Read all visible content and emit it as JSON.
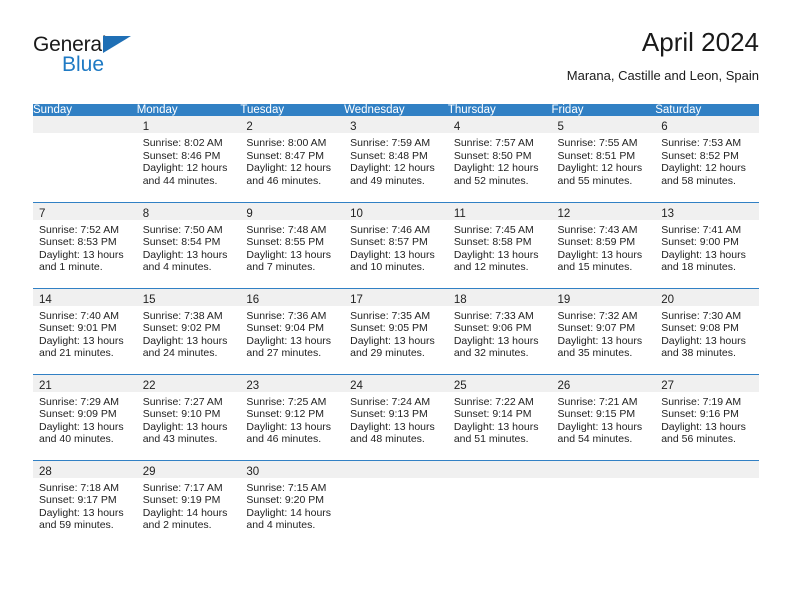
{
  "brand": {
    "name_top": "General",
    "name_bottom": "Blue",
    "triangle_color": "#1f6fb5",
    "blue_color": "#1f7ac4"
  },
  "header": {
    "month_title": "April 2024",
    "location": "Marana, Castille and Leon, Spain"
  },
  "theme": {
    "header_blue": "#3180c4",
    "daynum_band": "#f0f0f0",
    "text": "#222222"
  },
  "weekdays": [
    "Sunday",
    "Monday",
    "Tuesday",
    "Wednesday",
    "Thursday",
    "Friday",
    "Saturday"
  ],
  "labels": {
    "sunrise_prefix": "Sunrise:",
    "sunset_prefix": "Sunset:",
    "daylight_prefix": "Daylight:"
  },
  "weeks": [
    [
      {
        "day": "",
        "sunrise": "",
        "sunset": "",
        "daylight": ""
      },
      {
        "day": "1",
        "sunrise": "Sunrise: 8:02 AM",
        "sunset": "Sunset: 8:46 PM",
        "daylight": "Daylight: 12 hours and 44 minutes."
      },
      {
        "day": "2",
        "sunrise": "Sunrise: 8:00 AM",
        "sunset": "Sunset: 8:47 PM",
        "daylight": "Daylight: 12 hours and 46 minutes."
      },
      {
        "day": "3",
        "sunrise": "Sunrise: 7:59 AM",
        "sunset": "Sunset: 8:48 PM",
        "daylight": "Daylight: 12 hours and 49 minutes."
      },
      {
        "day": "4",
        "sunrise": "Sunrise: 7:57 AM",
        "sunset": "Sunset: 8:50 PM",
        "daylight": "Daylight: 12 hours and 52 minutes."
      },
      {
        "day": "5",
        "sunrise": "Sunrise: 7:55 AM",
        "sunset": "Sunset: 8:51 PM",
        "daylight": "Daylight: 12 hours and 55 minutes."
      },
      {
        "day": "6",
        "sunrise": "Sunrise: 7:53 AM",
        "sunset": "Sunset: 8:52 PM",
        "daylight": "Daylight: 12 hours and 58 minutes."
      }
    ],
    [
      {
        "day": "7",
        "sunrise": "Sunrise: 7:52 AM",
        "sunset": "Sunset: 8:53 PM",
        "daylight": "Daylight: 13 hours and 1 minute."
      },
      {
        "day": "8",
        "sunrise": "Sunrise: 7:50 AM",
        "sunset": "Sunset: 8:54 PM",
        "daylight": "Daylight: 13 hours and 4 minutes."
      },
      {
        "day": "9",
        "sunrise": "Sunrise: 7:48 AM",
        "sunset": "Sunset: 8:55 PM",
        "daylight": "Daylight: 13 hours and 7 minutes."
      },
      {
        "day": "10",
        "sunrise": "Sunrise: 7:46 AM",
        "sunset": "Sunset: 8:57 PM",
        "daylight": "Daylight: 13 hours and 10 minutes."
      },
      {
        "day": "11",
        "sunrise": "Sunrise: 7:45 AM",
        "sunset": "Sunset: 8:58 PM",
        "daylight": "Daylight: 13 hours and 12 minutes."
      },
      {
        "day": "12",
        "sunrise": "Sunrise: 7:43 AM",
        "sunset": "Sunset: 8:59 PM",
        "daylight": "Daylight: 13 hours and 15 minutes."
      },
      {
        "day": "13",
        "sunrise": "Sunrise: 7:41 AM",
        "sunset": "Sunset: 9:00 PM",
        "daylight": "Daylight: 13 hours and 18 minutes."
      }
    ],
    [
      {
        "day": "14",
        "sunrise": "Sunrise: 7:40 AM",
        "sunset": "Sunset: 9:01 PM",
        "daylight": "Daylight: 13 hours and 21 minutes."
      },
      {
        "day": "15",
        "sunrise": "Sunrise: 7:38 AM",
        "sunset": "Sunset: 9:02 PM",
        "daylight": "Daylight: 13 hours and 24 minutes."
      },
      {
        "day": "16",
        "sunrise": "Sunrise: 7:36 AM",
        "sunset": "Sunset: 9:04 PM",
        "daylight": "Daylight: 13 hours and 27 minutes."
      },
      {
        "day": "17",
        "sunrise": "Sunrise: 7:35 AM",
        "sunset": "Sunset: 9:05 PM",
        "daylight": "Daylight: 13 hours and 29 minutes."
      },
      {
        "day": "18",
        "sunrise": "Sunrise: 7:33 AM",
        "sunset": "Sunset: 9:06 PM",
        "daylight": "Daylight: 13 hours and 32 minutes."
      },
      {
        "day": "19",
        "sunrise": "Sunrise: 7:32 AM",
        "sunset": "Sunset: 9:07 PM",
        "daylight": "Daylight: 13 hours and 35 minutes."
      },
      {
        "day": "20",
        "sunrise": "Sunrise: 7:30 AM",
        "sunset": "Sunset: 9:08 PM",
        "daylight": "Daylight: 13 hours and 38 minutes."
      }
    ],
    [
      {
        "day": "21",
        "sunrise": "Sunrise: 7:29 AM",
        "sunset": "Sunset: 9:09 PM",
        "daylight": "Daylight: 13 hours and 40 minutes."
      },
      {
        "day": "22",
        "sunrise": "Sunrise: 7:27 AM",
        "sunset": "Sunset: 9:10 PM",
        "daylight": "Daylight: 13 hours and 43 minutes."
      },
      {
        "day": "23",
        "sunrise": "Sunrise: 7:25 AM",
        "sunset": "Sunset: 9:12 PM",
        "daylight": "Daylight: 13 hours and 46 minutes."
      },
      {
        "day": "24",
        "sunrise": "Sunrise: 7:24 AM",
        "sunset": "Sunset: 9:13 PM",
        "daylight": "Daylight: 13 hours and 48 minutes."
      },
      {
        "day": "25",
        "sunrise": "Sunrise: 7:22 AM",
        "sunset": "Sunset: 9:14 PM",
        "daylight": "Daylight: 13 hours and 51 minutes."
      },
      {
        "day": "26",
        "sunrise": "Sunrise: 7:21 AM",
        "sunset": "Sunset: 9:15 PM",
        "daylight": "Daylight: 13 hours and 54 minutes."
      },
      {
        "day": "27",
        "sunrise": "Sunrise: 7:19 AM",
        "sunset": "Sunset: 9:16 PM",
        "daylight": "Daylight: 13 hours and 56 minutes."
      }
    ],
    [
      {
        "day": "28",
        "sunrise": "Sunrise: 7:18 AM",
        "sunset": "Sunset: 9:17 PM",
        "daylight": "Daylight: 13 hours and 59 minutes."
      },
      {
        "day": "29",
        "sunrise": "Sunrise: 7:17 AM",
        "sunset": "Sunset: 9:19 PM",
        "daylight": "Daylight: 14 hours and 2 minutes."
      },
      {
        "day": "30",
        "sunrise": "Sunrise: 7:15 AM",
        "sunset": "Sunset: 9:20 PM",
        "daylight": "Daylight: 14 hours and 4 minutes."
      },
      {
        "day": "",
        "sunrise": "",
        "sunset": "",
        "daylight": ""
      },
      {
        "day": "",
        "sunrise": "",
        "sunset": "",
        "daylight": ""
      },
      {
        "day": "",
        "sunrise": "",
        "sunset": "",
        "daylight": ""
      },
      {
        "day": "",
        "sunrise": "",
        "sunset": "",
        "daylight": ""
      }
    ]
  ]
}
